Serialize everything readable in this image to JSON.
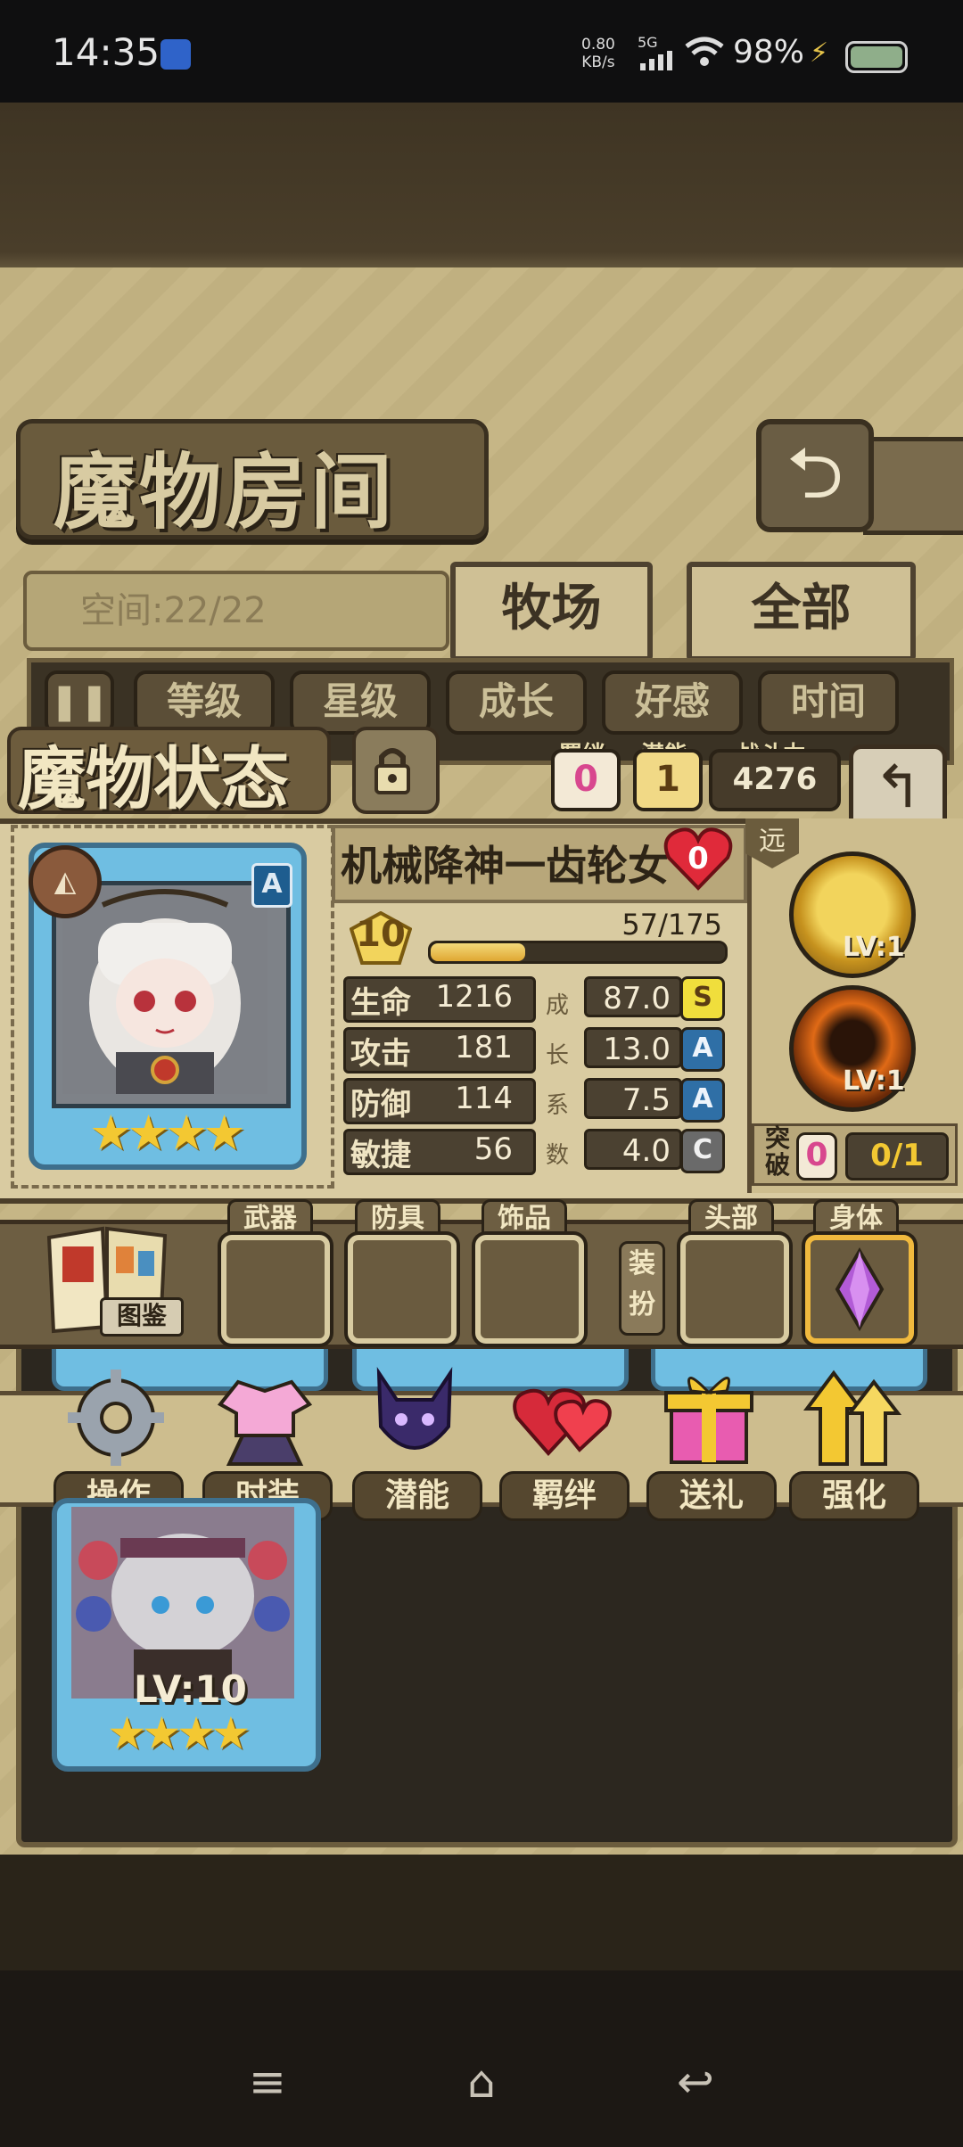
{
  "status_bar": {
    "time": "14:35",
    "net_speed": "0.80",
    "net_unit": "KB/s",
    "network": "5G",
    "battery": "98%"
  },
  "header": {
    "title": "魔物房间",
    "space_label": "空间:22/22",
    "tabs": [
      "牧场",
      "全部"
    ]
  },
  "filters": [
    "等级",
    "星级",
    "成长",
    "好感",
    "时间"
  ],
  "status_panel": {
    "title": "魔物状态",
    "bond_label": "羁绊",
    "bond_value": "0",
    "potential_label": "潜能",
    "potential_value": "1",
    "power_label": "战斗力",
    "power_value": "4276",
    "monster_name": "机械降神一齿轮女",
    "affection": "0",
    "card_grade": "A",
    "stars": 4,
    "level": "10",
    "exp_text": "57/175",
    "exp_fraction": 0.326,
    "growth_vertical_label": "成长系数",
    "stats": [
      {
        "name": "生命",
        "value": "1216",
        "growth": "87.0",
        "grade": "S"
      },
      {
        "name": "攻击",
        "value": "181",
        "growth": "13.0",
        "grade": "A"
      },
      {
        "name": "防御",
        "value": "114",
        "growth": "7.5",
        "grade": "A"
      },
      {
        "name": "敏捷",
        "value": "56",
        "growth": "4.0",
        "grade": "C"
      }
    ],
    "range_tag": "远",
    "skills": [
      {
        "level": "LV:1",
        "icon": "cannon-skill-icon"
      },
      {
        "level": "LV:1",
        "icon": "vortex-skill-icon"
      }
    ],
    "breakthrough_label": "突破",
    "breakthrough_value": "0",
    "breakthrough_progress": "0/1"
  },
  "equipment": {
    "codex_label": "图鉴",
    "slots": [
      "武器",
      "防具",
      "饰品"
    ],
    "dress_label": "装扮",
    "cosmetic_slots": [
      "头部",
      "身体"
    ]
  },
  "actions": [
    "操作",
    "时装",
    "潜能",
    "羁绊",
    "送礼",
    "强化"
  ],
  "roster": {
    "level": "LV:10",
    "stars": 4
  },
  "colors": {
    "accent_gold": "#f3c832",
    "card_blue": "#6fbee2",
    "parchment": "#d9cba1",
    "bond_pink": "#d8478e"
  }
}
